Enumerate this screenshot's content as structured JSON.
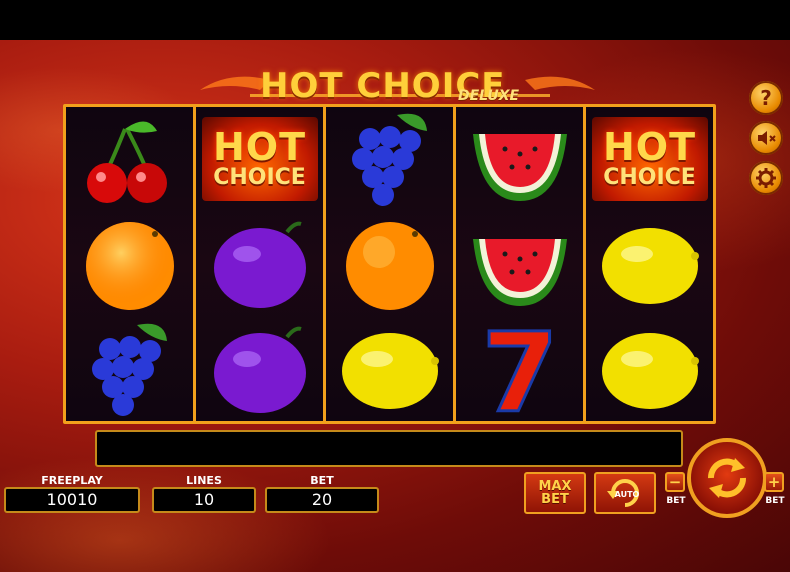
{
  "game": {
    "logo_title": "HOT CHOICE",
    "logo_subtitle": "DELUXE"
  },
  "colors": {
    "frame": "#f2a11c",
    "background": "#a81c10",
    "button_accent": "#ffd24a"
  },
  "reels": [
    [
      "cherries",
      "orange",
      "grapes"
    ],
    [
      "hot-choice",
      "plum",
      "plum"
    ],
    [
      "grapes",
      "orange",
      "lemon"
    ],
    [
      "watermelon",
      "watermelon",
      "seven"
    ],
    [
      "hot-choice",
      "lemon",
      "lemon"
    ]
  ],
  "symbols": {
    "hot_choice_line1": "HOT",
    "hot_choice_line2": "CHOICE",
    "seven": "7"
  },
  "side_buttons": {
    "help": "?"
  },
  "stats": {
    "freeplay_label": "FREEPLAY",
    "freeplay_value": "10010",
    "lines_label": "LINES",
    "lines_value": "10",
    "bet_label": "BET",
    "bet_value": "20"
  },
  "controls": {
    "max_line1": "MAX",
    "max_line2": "BET",
    "auto_label": "AUTO",
    "bet_minus_symbol": "−",
    "bet_minus_caption": "BET",
    "bet_plus_symbol": "+",
    "bet_plus_caption": "BET"
  }
}
